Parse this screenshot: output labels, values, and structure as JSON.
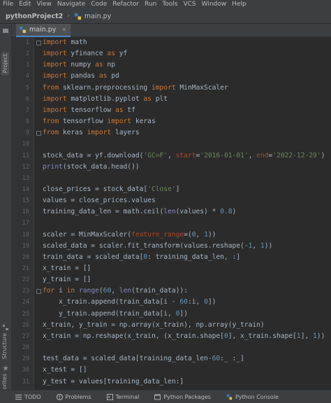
{
  "menu": [
    "File",
    "Edit",
    "View",
    "Navigate",
    "Code",
    "Refactor",
    "Run",
    "Tools",
    "VCS",
    "Window",
    "Help"
  ],
  "breadcrumb": {
    "project": "pythonProject2",
    "file": "main.py"
  },
  "sidebar": {
    "project_label": "Project",
    "structure_label": "Structure",
    "favorites_label": "Favorites"
  },
  "editor": {
    "tab_label": "main.py",
    "lines": [
      "import math",
      "import yfinance as yf",
      "import numpy as np",
      "import pandas as pd",
      "from sklearn.preprocessing import MinMaxScaler",
      "import matplotlib.pyplot as plt",
      "import tensorflow as tf",
      "from tensorflow import keras",
      "from keras import layers",
      "",
      "stock_data = yf.download('GC=F', start='2016-01-01', end='2022-12-29')",
      "print(stock_data.head())",
      "",
      "close_prices = stock_data['Close']",
      "values = close_prices.values",
      "training_data_len = math.ceil(len(values) * 0.8)",
      "",
      "scaler = MinMaxScaler(feature_range=(0, 1))",
      "scaled_data = scaler.fit_transform(values.reshape(-1, 1))",
      "train_data = scaled_data[0: training_data_len, :]",
      "x_train = []",
      "y_train = []",
      "for i in range(60, len(train_data)):",
      "    x_train.append(train_data[i - 60:i, 0])",
      "    y_train.append(train_data[i, 0])",
      "x_train, y_train = np.array(x_train), np.array(y_train)",
      "x_train = np.reshape(x_train, (x_train.shape[0], x_train.shape[1], 1))",
      "",
      "test_data = scaled_data[training_data_len-60:_ :_]",
      "x_test = []",
      "y_test = values[training_data_len:]"
    ]
  },
  "bottom_tools": [
    "TODO",
    "Problems",
    "Terminal",
    "Python Packages",
    "Python Console"
  ],
  "colors": {
    "background": "#2b2b2b",
    "keyword": "#cc7832",
    "string": "#6a8759",
    "number": "#6897bb",
    "param": "#aa4926",
    "builtin": "#8888c6",
    "text": "#a9b7c6"
  }
}
